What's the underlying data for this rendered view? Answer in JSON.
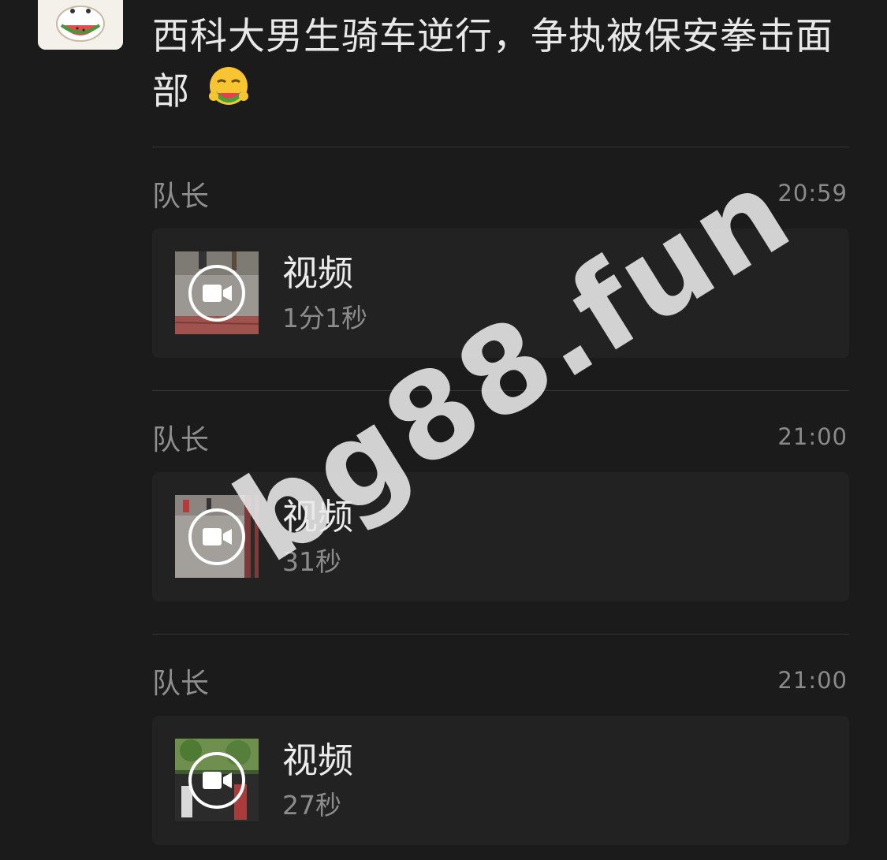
{
  "post": {
    "title": "西科大男生骑车逆行，争执被保安拳击面部",
    "emoji_icon": "watermelon-eating-face-emoji"
  },
  "messages": [
    {
      "sender": "队长",
      "time": "20:59",
      "card_title": "视频",
      "duration": "1分1秒",
      "thumb_icon": "video-camera-icon"
    },
    {
      "sender": "队长",
      "time": "21:00",
      "card_title": "视频",
      "duration": "31秒",
      "thumb_icon": "video-camera-icon"
    },
    {
      "sender": "队长",
      "time": "21:00",
      "card_title": "视频",
      "duration": "27秒",
      "thumb_icon": "video-camera-icon"
    }
  ],
  "watermark": "bg88.fun",
  "colors": {
    "background": "#1b1b1b",
    "card": "#222222",
    "muted_text": "#8e8e8e"
  }
}
